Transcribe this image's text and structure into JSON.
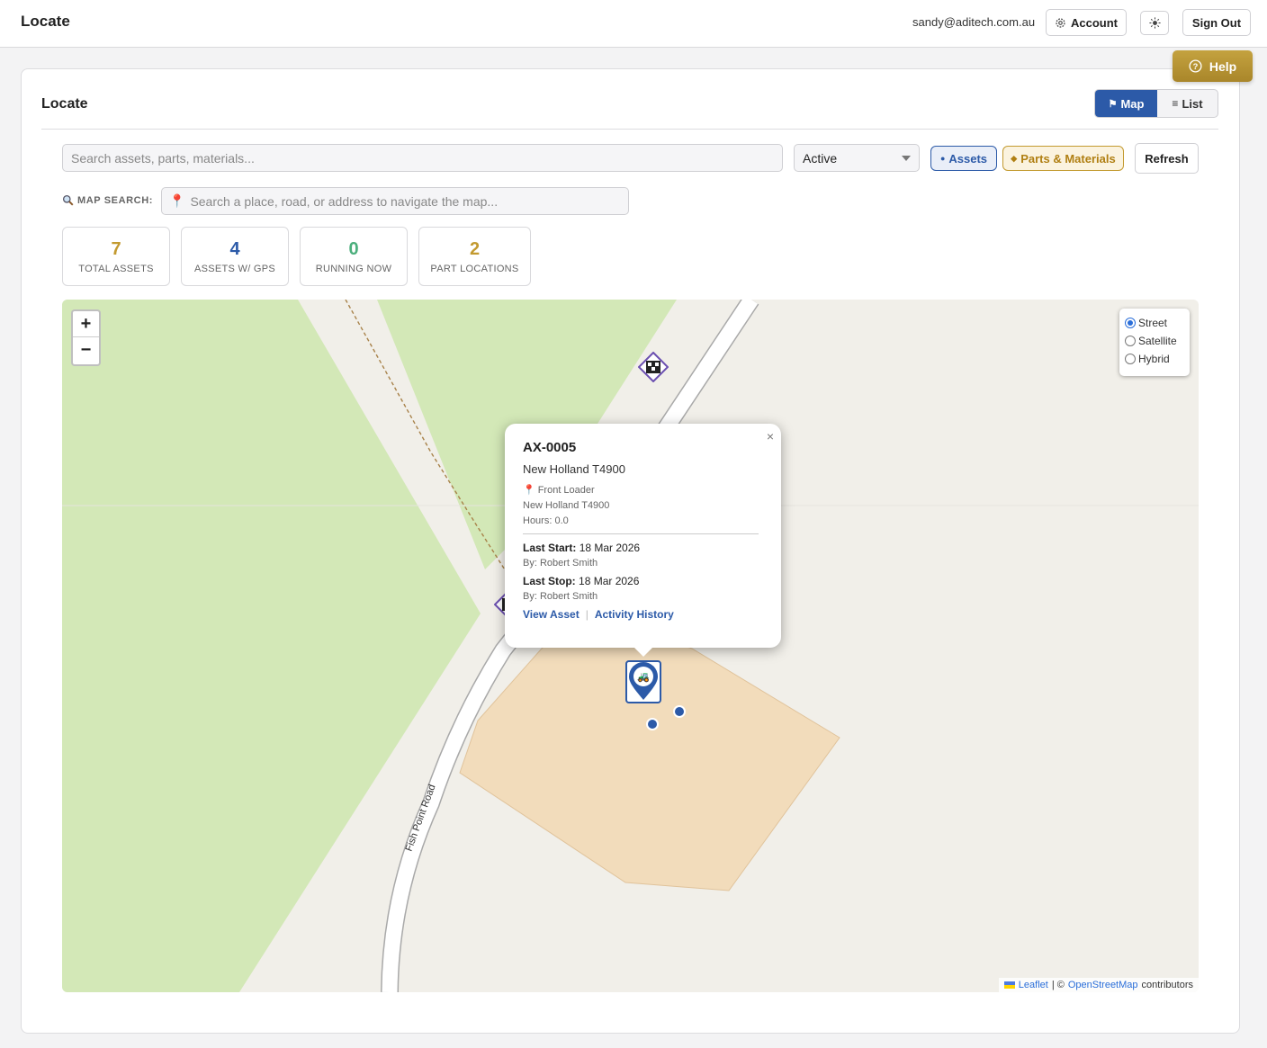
{
  "header": {
    "app_title": "Locate",
    "user_email": "sandy@aditech.com.au",
    "account_label": "Account",
    "sign_out_label": "Sign Out"
  },
  "help_label": "Help",
  "page": {
    "title": "Locate",
    "view_toggle": {
      "map_label": "Map",
      "list_label": "List",
      "active": "Map"
    }
  },
  "filters": {
    "search_placeholder": "Search assets, parts, materials...",
    "search_value": "",
    "status_value": "Active",
    "chip_assets": "Assets",
    "chip_parts": "Parts & Materials",
    "refresh_label": "Refresh",
    "map_search_label": "MAP SEARCH:",
    "map_search_placeholder": "Search a place, road, or address to navigate the map..."
  },
  "stats": [
    {
      "value": "7",
      "label": "TOTAL ASSETS",
      "color": "#c39a30"
    },
    {
      "value": "4",
      "label": "ASSETS W/ GPS",
      "color": "#2c5aa8"
    },
    {
      "value": "0",
      "label": "RUNNING NOW",
      "color": "#4caf7d"
    },
    {
      "value": "2",
      "label": "PART LOCATIONS",
      "color": "#c39a30"
    }
  ],
  "map": {
    "zoom_in": "+",
    "zoom_out": "−",
    "layers": [
      {
        "label": "Street",
        "selected": true
      },
      {
        "label": "Satellite",
        "selected": false
      },
      {
        "label": "Hybrid",
        "selected": false
      }
    ],
    "road_label": "Fish Point Road",
    "attribution": {
      "leaflet": "Leaflet",
      "separator": "| ©",
      "osm": "OpenStreetMap",
      "suffix": "contributors"
    },
    "colors": {
      "land": "#f1efe9",
      "park": "#d3e8b7",
      "farm": "#f2dcbb",
      "road": "#ffffff",
      "marker": "#2c5aa8",
      "part_marker": "#6b4fb0"
    }
  },
  "popup": {
    "asset_id": "AX-0005",
    "model": "New Holland T4900",
    "type": "Front Loader",
    "model_line": "New Holland T4900",
    "hours": "Hours: 0.0",
    "last_start_label": "Last Start:",
    "last_start_value": "18 Mar 2026",
    "last_start_by": "By: Robert Smith",
    "last_stop_label": "Last Stop:",
    "last_stop_value": "18 Mar 2026",
    "last_stop_by": "By: Robert Smith",
    "link_view": "View Asset",
    "link_history": "Activity History",
    "close": "×"
  }
}
